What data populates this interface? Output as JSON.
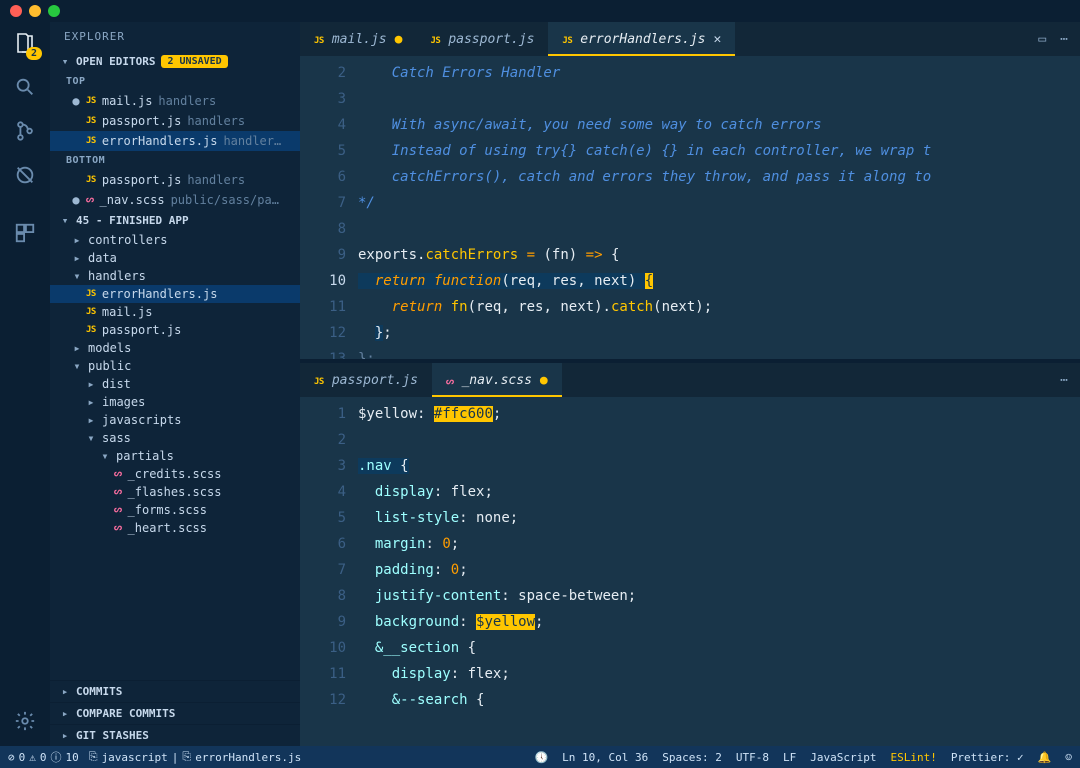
{
  "sidebar": {
    "title": "EXPLORER",
    "openEditors": {
      "label": "OPEN EDITORS",
      "badge": "2 UNSAVED"
    },
    "groupTop": "TOP",
    "groupBottom": "BOTTOM",
    "topFiles": [
      {
        "name": "mail.js",
        "dir": "handlers",
        "type": "JS",
        "mod": true
      },
      {
        "name": "passport.js",
        "dir": "handlers",
        "type": "JS",
        "mod": false
      },
      {
        "name": "errorHandlers.js",
        "dir": "handler…",
        "type": "JS",
        "mod": false,
        "active": true
      }
    ],
    "bottomFiles": [
      {
        "name": "passport.js",
        "dir": "handlers",
        "type": "JS",
        "mod": false
      },
      {
        "name": "_nav.scss",
        "dir": "public/sass/pa…",
        "type": "SCSS",
        "mod": true
      }
    ],
    "project": "45 - FINISHED APP",
    "tree": [
      {
        "d": 1,
        "t": "folder",
        "n": "controllers",
        "open": false
      },
      {
        "d": 1,
        "t": "folder",
        "n": "data",
        "open": false
      },
      {
        "d": 1,
        "t": "folder",
        "n": "handlers",
        "open": true
      },
      {
        "d": 2,
        "t": "file",
        "n": "errorHandlers.js",
        "ft": "JS",
        "sel": true
      },
      {
        "d": 2,
        "t": "file",
        "n": "mail.js",
        "ft": "JS"
      },
      {
        "d": 2,
        "t": "file",
        "n": "passport.js",
        "ft": "JS"
      },
      {
        "d": 1,
        "t": "folder",
        "n": "models",
        "open": false
      },
      {
        "d": 1,
        "t": "folder",
        "n": "public",
        "open": true
      },
      {
        "d": 2,
        "t": "folder",
        "n": "dist",
        "open": false
      },
      {
        "d": 2,
        "t": "folder",
        "n": "images",
        "open": false
      },
      {
        "d": 2,
        "t": "folder",
        "n": "javascripts",
        "open": false
      },
      {
        "d": 2,
        "t": "folder",
        "n": "sass",
        "open": true
      },
      {
        "d": 3,
        "t": "folder",
        "n": "partials",
        "open": true
      },
      {
        "d": 4,
        "t": "file",
        "n": "_credits.scss",
        "ft": "SCSS"
      },
      {
        "d": 4,
        "t": "file",
        "n": "_flashes.scss",
        "ft": "SCSS"
      },
      {
        "d": 4,
        "t": "file",
        "n": "_forms.scss",
        "ft": "SCSS"
      },
      {
        "d": 4,
        "t": "file",
        "n": "_heart.scss",
        "ft": "SCSS"
      }
    ],
    "sections": [
      "COMMITS",
      "COMPARE COMMITS",
      "GIT STASHES"
    ]
  },
  "activityBadge": "2",
  "tabsTop": [
    {
      "name": "mail.js",
      "ft": "JS",
      "mod": true
    },
    {
      "name": "passport.js",
      "ft": "JS"
    },
    {
      "name": "errorHandlers.js",
      "ft": "JS",
      "active": true,
      "close": true
    }
  ],
  "tabsBottom": [
    {
      "name": "passport.js",
      "ft": "JS"
    },
    {
      "name": "_nav.scss",
      "ft": "SCSS",
      "active": true,
      "mod": true
    }
  ],
  "codeTop": {
    "lines": [
      {
        "n": 2,
        "html": "    <span class='cm'>Catch Errors Handler</span>"
      },
      {
        "n": 3,
        "html": ""
      },
      {
        "n": 4,
        "html": "    <span class='cm'>With async/await, you need some way to catch errors</span>"
      },
      {
        "n": 5,
        "html": "    <span class='cm'>Instead of using try{} catch(e) {} in each controller, we wrap t</span>"
      },
      {
        "n": 6,
        "html": "    <span class='cm'>catchErrors(), catch and errors they throw, and pass it along to</span>"
      },
      {
        "n": 7,
        "html": "<span class='cm'>*/</span>"
      },
      {
        "n": 8,
        "html": ""
      },
      {
        "n": 9,
        "html": "<span class='id'>exports</span><span class='pn'>.</span><span class='fn'>catchErrors</span> <span class='op'>=</span> <span class='pn'>(</span><span class='id'>fn</span><span class='pn'>)</span> <span class='op'>=&gt;</span> <span class='pn'>{</span>"
      },
      {
        "n": 10,
        "cur": true,
        "html": "<span class='hl'>  <span class='kw'>return</span> <span class='kw'>function</span><span class='pn'>(</span><span class='id'>req</span><span class='pn'>,</span> <span class='id'>res</span><span class='pn'>,</span> <span class='id'>next</span><span class='pn'>)</span> <span class='cursor-box'>{</span></span>"
      },
      {
        "n": 11,
        "html": "    <span class='kw'>return</span> <span class='fn'>fn</span><span class='pn'>(</span><span class='id'>req</span><span class='pn'>,</span> <span class='id'>res</span><span class='pn'>,</span> <span class='id'>next</span><span class='pn'>)</span><span class='pn'>.</span><span class='fn'>catch</span><span class='pn'>(</span><span class='id'>next</span><span class='pn'>);</span>"
      },
      {
        "n": 12,
        "html": "  <span class='hl'><span class='pn'>}</span></span><span class='pn'>;</span>"
      },
      {
        "n": 13,
        "html": "<span class='dim'>};</span>"
      }
    ]
  },
  "codeBottom": {
    "lines": [
      {
        "n": 1,
        "html": "<span class='id'>$yellow</span><span class='pn'>:</span> <span class='str'>#ffc600</span><span class='pn'>;</span>"
      },
      {
        "n": 2,
        "html": ""
      },
      {
        "n": 3,
        "html": "<span class='hl'><span class='sel'>.nav</span> <span class='pn'>{</span></span>"
      },
      {
        "n": 4,
        "html": "  <span class='prop'>display</span><span class='pn'>:</span> <span class='id'>flex</span><span class='pn'>;</span>"
      },
      {
        "n": 5,
        "html": "  <span class='prop'>list-style</span><span class='pn'>:</span> <span class='id'>none</span><span class='pn'>;</span>"
      },
      {
        "n": 6,
        "html": "  <span class='prop'>margin</span><span class='pn'>:</span> <span class='val'>0</span><span class='pn'>;</span>"
      },
      {
        "n": 7,
        "html": "  <span class='prop'>padding</span><span class='pn'>:</span> <span class='val'>0</span><span class='pn'>;</span>"
      },
      {
        "n": 8,
        "html": "  <span class='prop'>justify-content</span><span class='pn'>:</span> <span class='id'>space-between</span><span class='pn'>;</span>"
      },
      {
        "n": 9,
        "html": "  <span class='prop'>background</span><span class='pn'>:</span> <span class='str'>$yellow</span><span class='pn'>;</span>"
      },
      {
        "n": 10,
        "html": "  <span class='sel'>&amp;__section</span> <span class='pn'>{</span>"
      },
      {
        "n": 11,
        "html": "    <span class='prop'>display</span><span class='pn'>:</span> <span class='id'>flex</span><span class='pn'>;</span>"
      },
      {
        "n": 12,
        "html": "    <span class='sel'>&amp;--search</span> <span class='pn'>{</span>"
      }
    ]
  },
  "status": {
    "errors": "0",
    "warnings": "0",
    "info": "10",
    "lang1": "javascript",
    "file": "errorHandlers.js",
    "pos": "Ln 10, Col 36",
    "spaces": "Spaces: 2",
    "enc": "UTF-8",
    "eol": "LF",
    "langMode": "JavaScript",
    "eslint": "ESLint!",
    "prettier": "Prettier: ✓"
  }
}
